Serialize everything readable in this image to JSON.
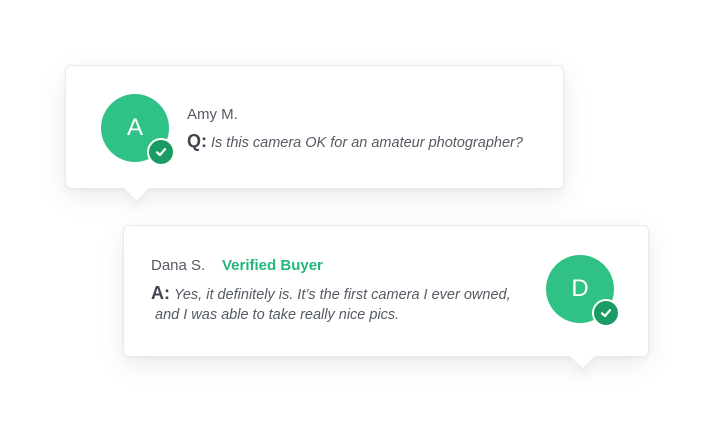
{
  "colors": {
    "brand_green": "#2fc185",
    "badge_green": "#1a9a64",
    "verified_green": "#23b77a"
  },
  "question": {
    "avatar_letter": "A",
    "author": "Amy M.",
    "prefix": "Q:",
    "text": "Is this camera OK for an amateur photographer?",
    "badge_icon": "check-icon"
  },
  "answer": {
    "avatar_letter": "D",
    "author": "Dana S.",
    "verified_label": "Verified Buyer",
    "prefix": "A:",
    "text_line1": "Yes, it definitely is. It’s the first camera I ever owned,",
    "text_line2": "and I was able to take really nice pics.",
    "badge_icon": "check-icon"
  }
}
